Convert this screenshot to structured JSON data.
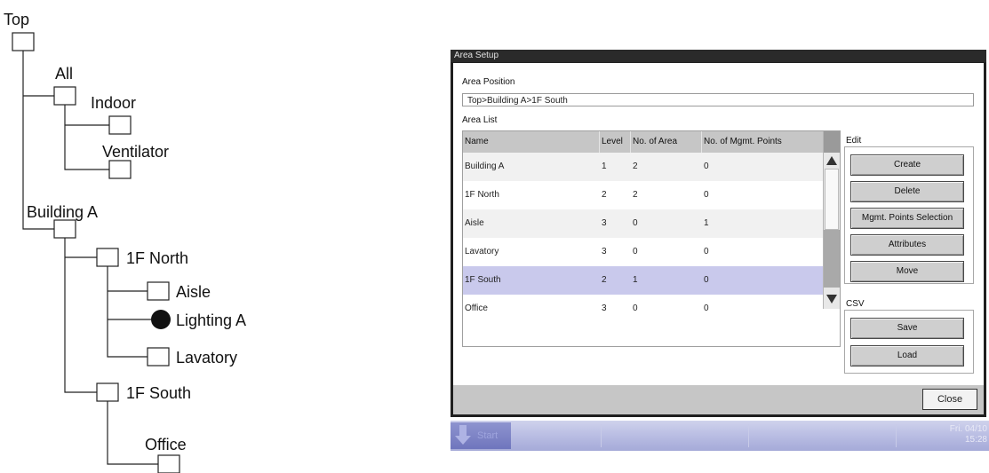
{
  "tree": {
    "nodes": {
      "top": "Top",
      "all": "All",
      "indoor": "Indoor",
      "ventilator": "Ventilator",
      "building_a": "Building A",
      "north": "1F North",
      "aisle": "Aisle",
      "lighting_a": "Lighting A",
      "lavatory": "Lavatory",
      "south": "1F South",
      "office": "Office"
    }
  },
  "window": {
    "title": "Area Setup",
    "area_position_label": "Area Position",
    "area_position_value": "Top>Building A>1F South",
    "area_list_label": "Area List",
    "columns": [
      "Name",
      "Level",
      "No. of Area",
      "No. of Mgmt. Points"
    ],
    "rows": [
      {
        "name": "Building A",
        "level": "1",
        "areas": "2",
        "points": "0"
      },
      {
        "name": "1F North",
        "level": "2",
        "areas": "2",
        "points": "0"
      },
      {
        "name": "Aisle",
        "level": "3",
        "areas": "0",
        "points": "1"
      },
      {
        "name": "Lavatory",
        "level": "3",
        "areas": "0",
        "points": "0"
      },
      {
        "name": "1F South",
        "level": "2",
        "areas": "1",
        "points": "0"
      },
      {
        "name": "Office",
        "level": "3",
        "areas": "0",
        "points": "0"
      }
    ],
    "edit": {
      "label": "Edit",
      "create": "Create",
      "delete": "Delete",
      "mgmt_points": "Mgmt. Points Selection",
      "attributes": "Attributes",
      "move": "Move"
    },
    "csv": {
      "label": "CSV",
      "save": "Save",
      "load": "Load"
    },
    "close": "Close"
  },
  "taskbar": {
    "start_label": "Start",
    "date": "Fri. 04/10",
    "time": "15:28"
  },
  "colors": {
    "selected_row": "#c9c9ec",
    "taskbar": "#b9bde3",
    "window_frame": "#1f1f1f"
  }
}
